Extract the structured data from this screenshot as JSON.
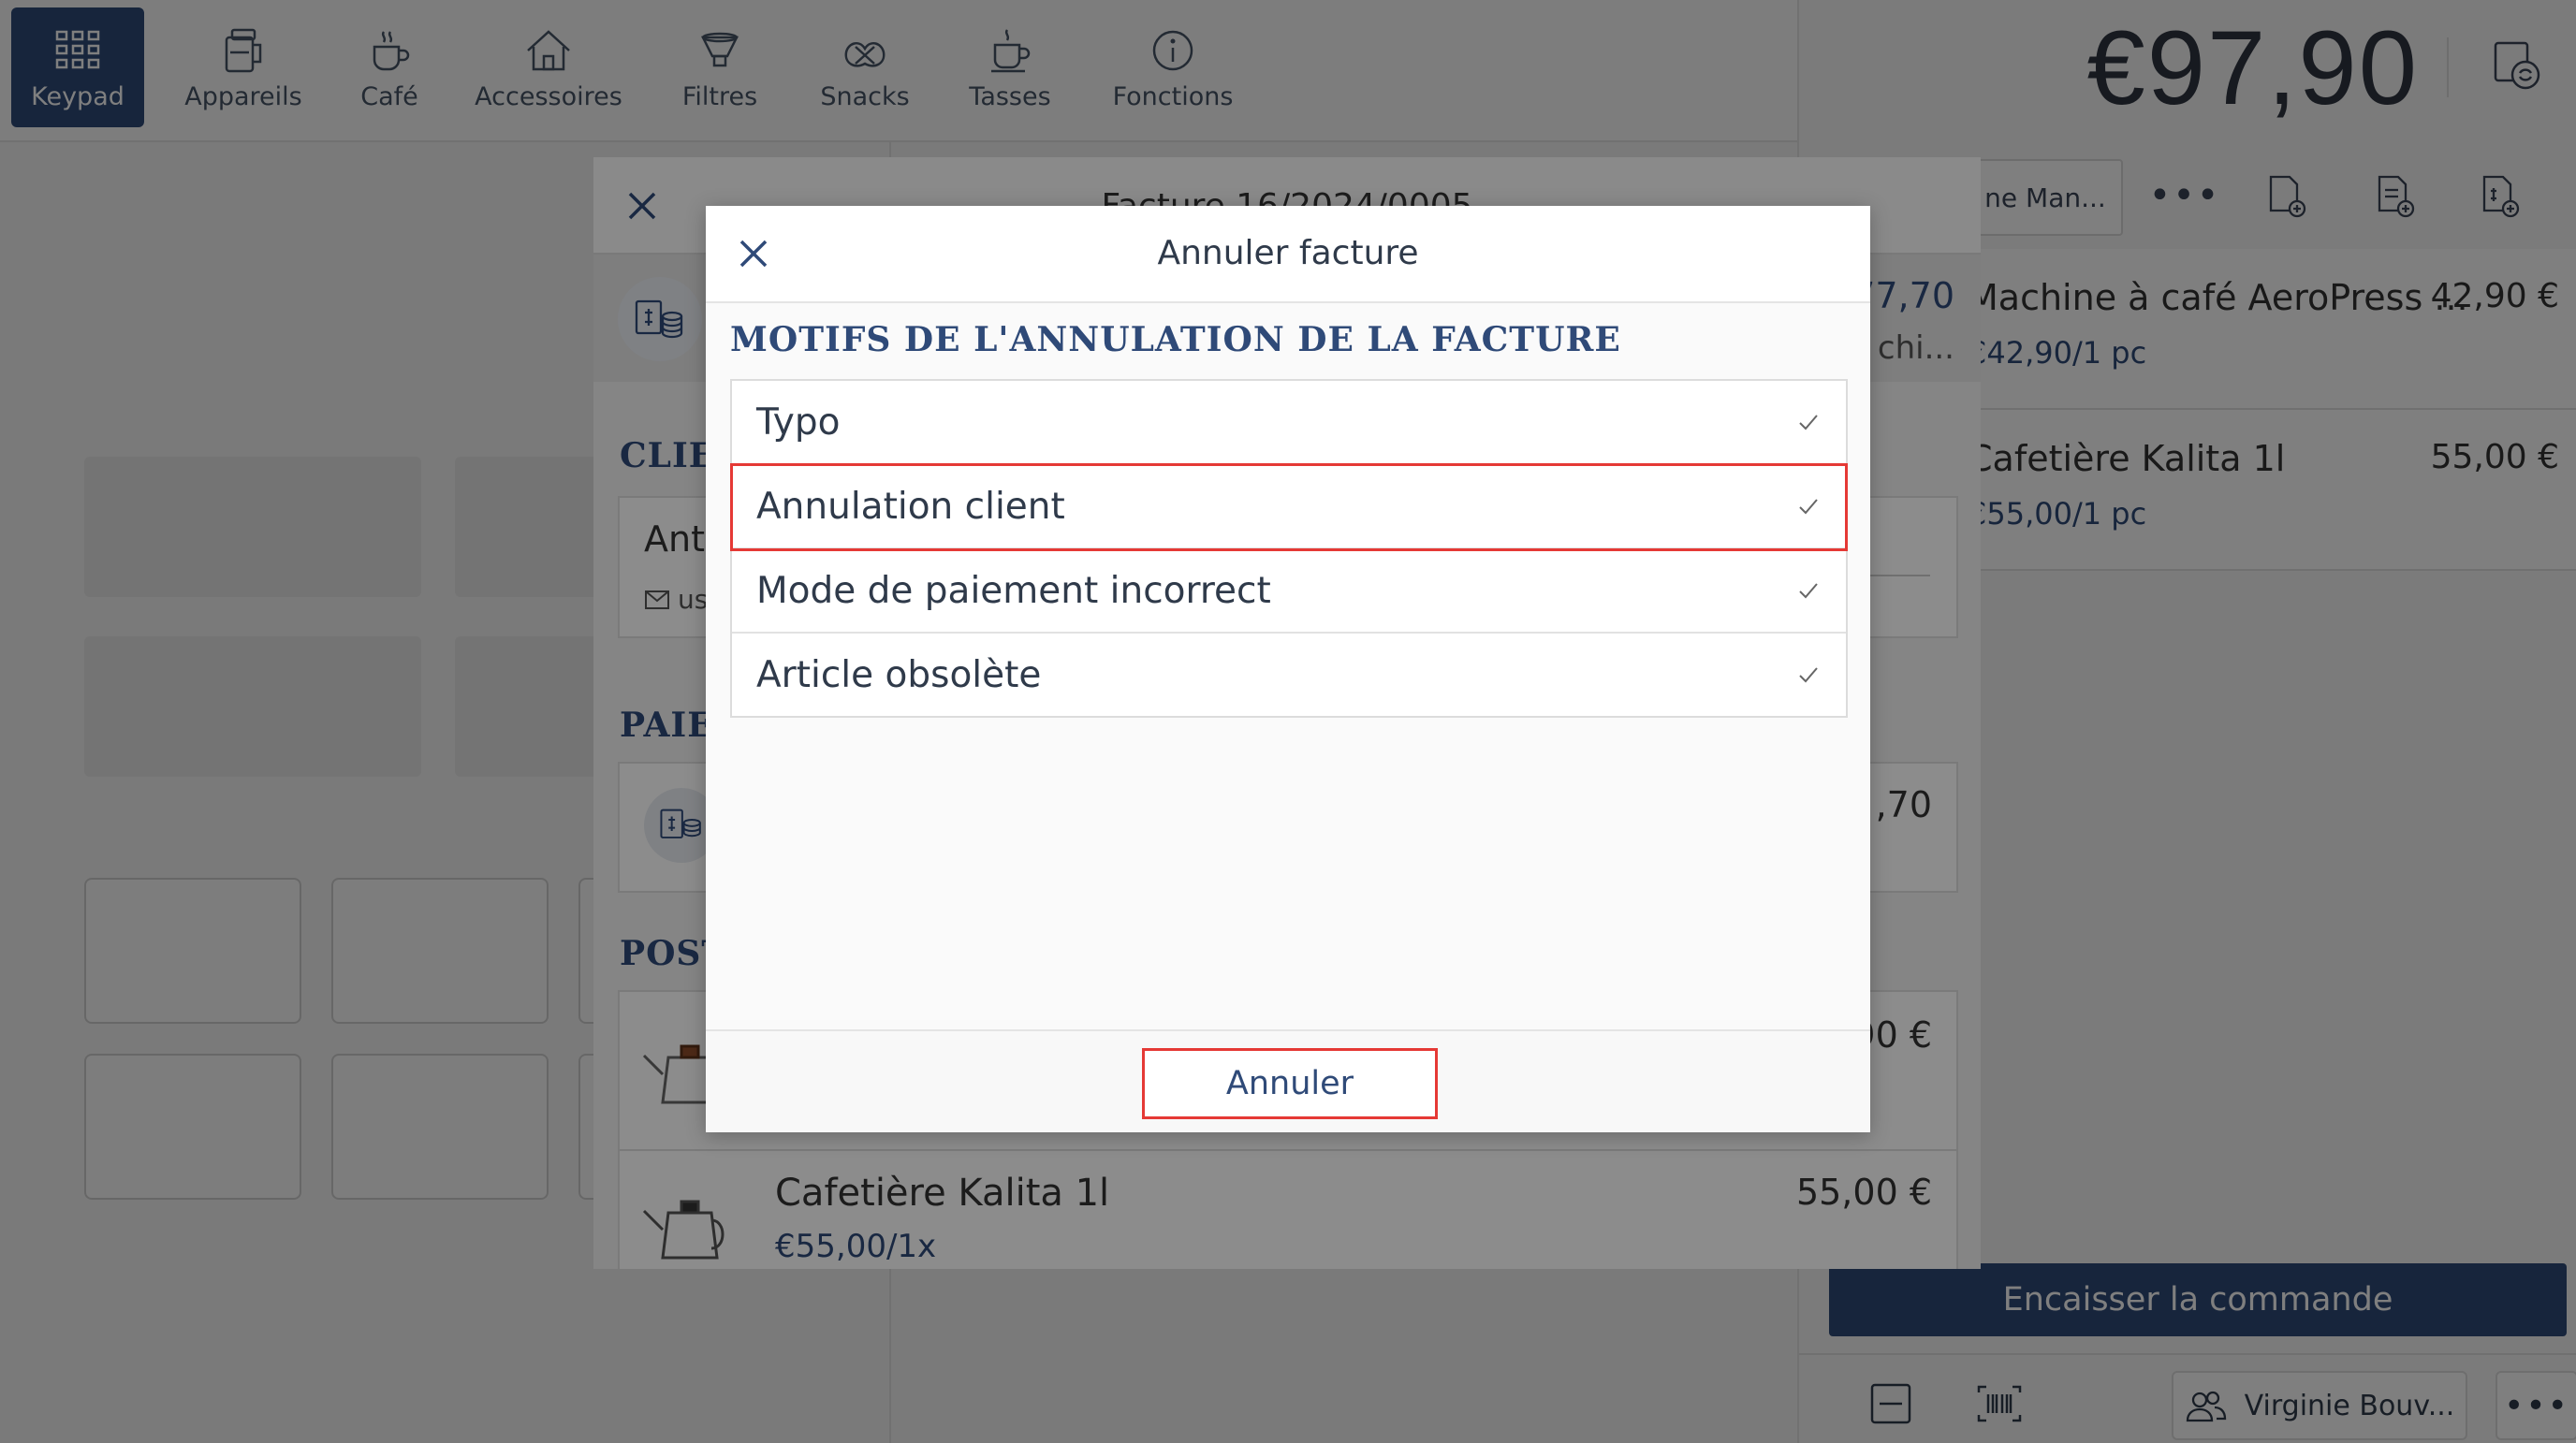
{
  "nav": {
    "items": [
      {
        "label": "Keypad",
        "icon": "keypad-icon",
        "active": true
      },
      {
        "label": "Appareils",
        "icon": "appliance-icon"
      },
      {
        "label": "Café",
        "icon": "coffee-cup-icon"
      },
      {
        "label": "Accessoires",
        "icon": "house-icon"
      },
      {
        "label": "Filtres",
        "icon": "filter-icon"
      },
      {
        "label": "Snacks",
        "icon": "pretzel-icon"
      },
      {
        "label": "Tasses",
        "icon": "cup-icon"
      },
      {
        "label": "Fonctions",
        "icon": "info-icon"
      }
    ]
  },
  "right_panel": {
    "total": "€97,90",
    "customer_button": "ne Man...",
    "order_lines": [
      {
        "name": "Machine à café AeroPress ...",
        "sub": "€42,90/1 pc",
        "price": "42,90 €"
      },
      {
        "name": "Cafetière Kalita 1l",
        "sub": "€55,00/1 pc",
        "price": "55,00 €"
      }
    ],
    "checkout_label": "Encaisser la commande",
    "salesperson": "Virginie Bouv..."
  },
  "invoice_dialog": {
    "title": "Facture 16/2024/0005",
    "amount_partial": "77,70",
    "method_partial": "chi...",
    "section_client": "CLIEN",
    "client_name_partial": "Ant",
    "client_email_partial": "us",
    "section_payment": "PAIEM",
    "payment_amount_partial": ",70",
    "section_items": "POSTE",
    "item1_price_partial": "90 €",
    "item2": {
      "name": "Cafetière Kalita 1l",
      "sub": "€55,00/1x",
      "price": "55,00 €"
    }
  },
  "modal": {
    "title": "Annuler facture",
    "section_label": "MOTIFS DE L'ANNULATION DE LA FACTURE",
    "reasons": [
      {
        "label": "Typo"
      },
      {
        "label": "Annulation client",
        "highlighted": true
      },
      {
        "label": "Mode de paiement incorrect"
      },
      {
        "label": "Article obsolète"
      }
    ],
    "cancel_button": "Annuler"
  },
  "colors": {
    "accent": "#2f4a78",
    "highlight": "#e53935",
    "overlay": "rgba(0,0,0,0.5)"
  }
}
